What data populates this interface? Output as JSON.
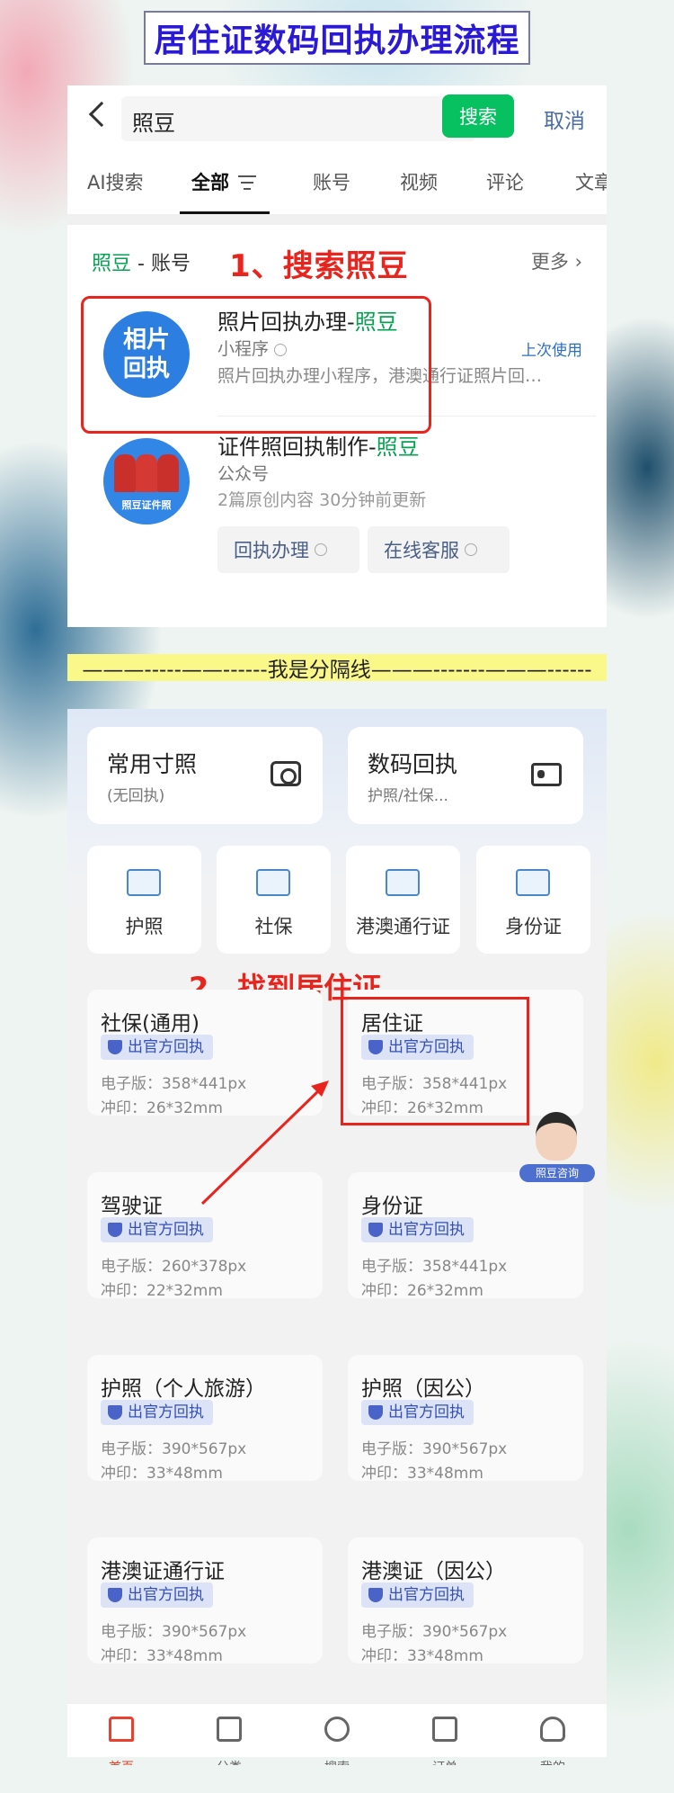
{
  "title": "居住证数码回执办理流程",
  "search": {
    "query": "照豆",
    "button": "搜索",
    "cancel": "取消",
    "tabs": [
      "AI搜索",
      "全部",
      "账号",
      "视频",
      "评论",
      "文章"
    ],
    "section_prefix": "照豆",
    "section_suffix": " - 账号",
    "more": "更多",
    "step1": "1、搜索照豆",
    "results": [
      {
        "logo_text": "相片回执",
        "name_prefix": "照片回执办理-",
        "name_highlight": "照豆",
        "type": "小程序",
        "last_used": "上次使用",
        "desc": "照片回执办理小程序，港澳通行证照片回…"
      },
      {
        "logo_text": "照豆证件照",
        "name_prefix": "证件照回执制作-",
        "name_highlight": "照豆",
        "type": "公众号",
        "desc": "2篇原创内容  30分钟前更新",
        "services": [
          "回执办理",
          "在线客服"
        ]
      }
    ]
  },
  "separator": "———-----——------我是分隔线———-------———------",
  "app": {
    "top_cards": [
      {
        "title": "常用寸照",
        "sub": "(无回执)",
        "icon": "camera-icon"
      },
      {
        "title": "数码回执",
        "sub": "护照/社保...",
        "icon": "id-card-icon"
      }
    ],
    "categories": [
      "护照",
      "社保",
      "港澳通行证",
      "身份证"
    ],
    "step2": "2、找到居住证",
    "badge": "出官方回执",
    "docs": [
      {
        "name": "社保(通用)",
        "size": "电子版：358*441px",
        "print": "冲印：26*32mm"
      },
      {
        "name": "居住证",
        "size": "电子版：358*441px",
        "print": "冲印：26*32mm"
      },
      {
        "name": "驾驶证",
        "size": "电子版：260*378px",
        "print": "冲印：22*32mm"
      },
      {
        "name": "身份证",
        "size": "电子版：358*441px",
        "print": "冲印：26*32mm"
      },
      {
        "name": "护照（个人旅游）",
        "size": "电子版：390*567px",
        "print": "冲印：33*48mm"
      },
      {
        "name": "护照（因公）",
        "size": "电子版：390*567px",
        "print": "冲印：33*48mm"
      },
      {
        "name": "港澳证通行证",
        "size": "电子版：390*567px",
        "print": "冲印：33*48mm"
      },
      {
        "name": "港澳证（因公）",
        "size": "电子版：390*567px",
        "print": "冲印：33*48mm"
      }
    ],
    "consult": "照豆咨询",
    "nav": [
      "首页",
      "分类",
      "搜索",
      "订单",
      "我的"
    ]
  },
  "colors": {
    "accent_green": "#07c160",
    "annotation_red": "#e8241d",
    "title_blue": "#2a19d6"
  }
}
